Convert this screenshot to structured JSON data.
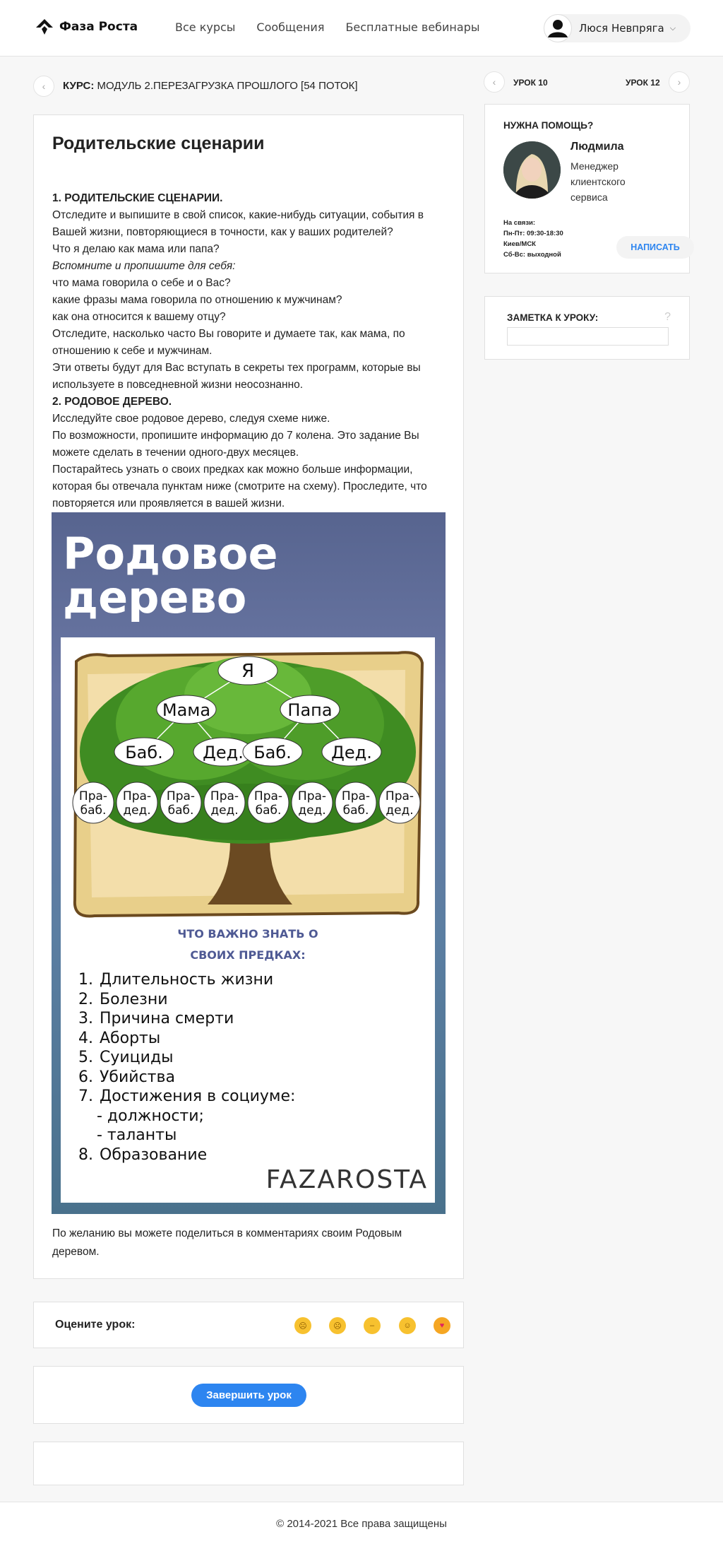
{
  "header": {
    "logo": "Фаза Роста",
    "nav": [
      "Все курсы",
      "Сообщения",
      "Бесплатные вебинары"
    ],
    "user_name": "Люся Невпряга"
  },
  "breadcrumb": {
    "label": "КУРС:",
    "value": "МОДУЛЬ 2.ПЕРЕЗАГРУЗКА ПРОШЛОГО [54 ПОТОК]"
  },
  "lesson": {
    "title": "Родительские сценарии",
    "paragraphs": [
      {
        "text": "1. РОДИТЕЛЬСКИЕ СЦЕНАРИИ.",
        "style": "b"
      },
      {
        "text": "Отследите и выпишите в свой список, какие-нибудь ситуации, события в Вашей жизни, повторяющиеся в точности, как у ваших родителей?",
        "style": ""
      },
      {
        "text": "Что я делаю как мама или папа?",
        "style": ""
      },
      {
        "text": "Вспомните и пропишите для себя:",
        "style": "i"
      },
      {
        "text": "что мама говорила о себе и о Вас?",
        "style": ""
      },
      {
        "text": "какие фразы мама говорила по отношению к мужчинам?",
        "style": ""
      },
      {
        "text": "как она относится к вашему отцу?",
        "style": ""
      },
      {
        "text": "Отследите, насколько часто Вы говорите и думаете так, как мама, по отношению к себе и мужчинам.",
        "style": ""
      },
      {
        "text": "Эти ответы будут для Вас вступать в секреты тех программ, которые вы используете в повседневной жизни неосознанно.",
        "style": ""
      },
      {
        "text": "2. РОДОВОЕ ДЕРЕВО.",
        "style": "b"
      },
      {
        "text": "Исследуйте свое родовое дерево, следуя схеме ниже.",
        "style": ""
      },
      {
        "text": "По возможности, пропишите информацию до 7 колена. Это задание Вы можете сделать в течении одного-двух месяцев.",
        "style": ""
      },
      {
        "text": "Постарайтесь узнать о своих предках как можно больше информации, которая бы отвечала пунктам ниже (смотрите на схему). Проследите, что повторяется или проявляется в вашей жизни.",
        "style": ""
      }
    ],
    "outro": "По желанию вы можете поделиться в комментариях своим Родовым деревом."
  },
  "poster": {
    "title_line1": "Родовое",
    "title_line2": "дерево",
    "tree": {
      "me": "Я",
      "parents": [
        "Мама",
        "Папа"
      ],
      "grandparents": [
        "Баб.",
        "Дед.",
        "Баб.",
        "Дед."
      ],
      "great_top": [
        "Пра-",
        "Пра-",
        "Пра-",
        "Пра-",
        "Пра-",
        "Пра-",
        "Пра-",
        "Пра-"
      ],
      "great_bottom": [
        "баб.",
        "дед.",
        "баб.",
        "дед.",
        "баб.",
        "дед.",
        "баб.",
        "дед."
      ]
    },
    "subtitle_line1": "ЧТО ВАЖНО ЗНАТЬ О",
    "subtitle_line2": "СВОИХ ПРЕДКАХ:",
    "list": [
      {
        "num": "1.",
        "text": "Длительность жизни"
      },
      {
        "num": "2.",
        "text": "Болезни"
      },
      {
        "num": "3.",
        "text": "Причина смерти"
      },
      {
        "num": "4.",
        "text": "Аборты"
      },
      {
        "num": "5.",
        "text": "Суициды"
      },
      {
        "num": "6.",
        "text": "Убийства"
      },
      {
        "num": "7.",
        "text": "Достижения в социуме:"
      }
    ],
    "sublist": [
      "- должности;",
      "- таланты"
    ],
    "last_item": {
      "num": "8.",
      "text": "Образование"
    },
    "brand": "FAZAROSTA"
  },
  "rating": {
    "label": "Оцените урок:",
    "emojis": [
      "angry-emoji",
      "sad-emoji",
      "meh-emoji",
      "smile-emoji",
      "love-emoji"
    ]
  },
  "finish_button": "Завершить урок",
  "footer": "© 2014-2021 Все права защищены",
  "sidebar": {
    "prev_lesson": "УРОК 10",
    "next_lesson": "УРОК 12",
    "help_title": "НУЖНА ПОМОЩЬ?",
    "manager_name": "Людмила",
    "manager_role": "Менеджер клиентского сервиса",
    "contact_lines": [
      "На связи:",
      "Пн-Пт: 09:30-18:30",
      "Киев/МСК",
      "Сб-Вс: выходной"
    ],
    "write_button": "НАПИСАТЬ",
    "note_title": "ЗАМЕТКА К УРОКУ:",
    "note_placeholder": "",
    "note_help": "?"
  },
  "colors": {
    "accent": "#2d85f0",
    "poster_purple": "#4f5a94"
  }
}
